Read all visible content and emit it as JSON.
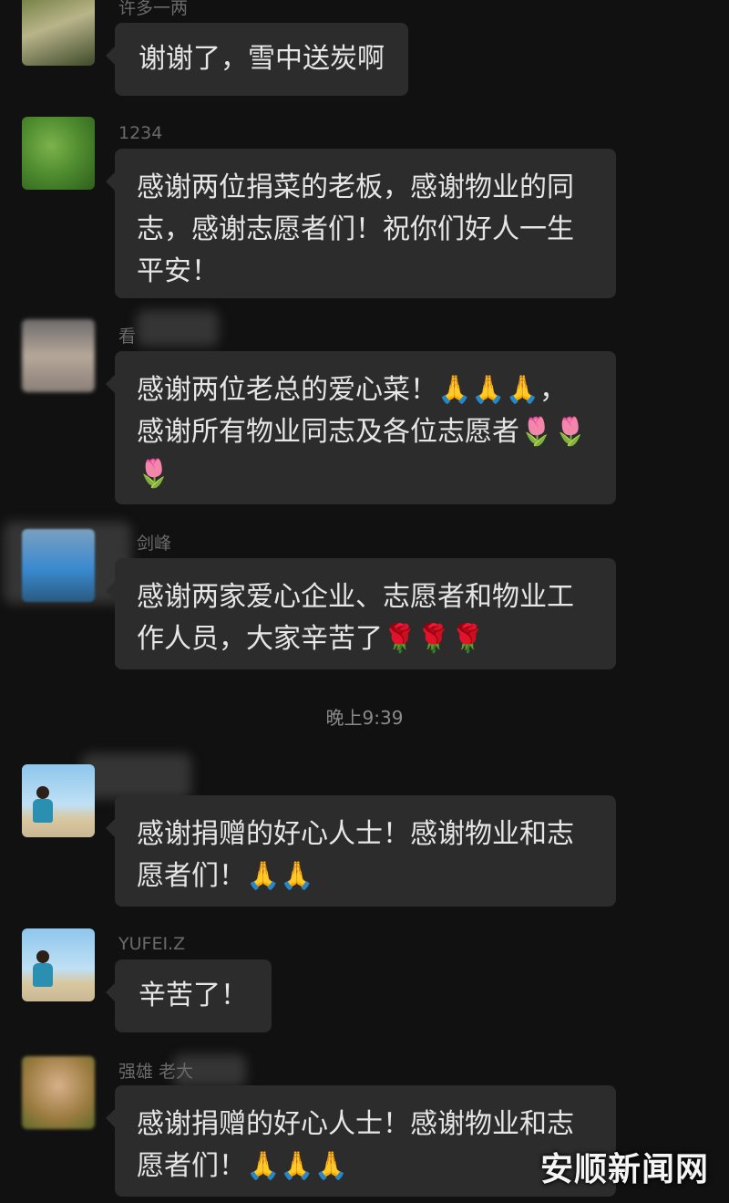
{
  "chat": {
    "messages": [
      {
        "sender": "许多一两",
        "text": "谢谢了，雪中送炭啊"
      },
      {
        "sender": "1234",
        "text": "感谢两位捐菜的老板，感谢物业的同志，感谢志愿者们！祝你们好人一生平安！"
      },
      {
        "sender": "看",
        "text": "感谢两位老总的爱心菜！🙏🙏🙏，感谢所有物业同志及各位志愿者🌷🌷🌷"
      },
      {
        "sender": "剑峰",
        "text": "感谢两家爱心企业、志愿者和物业工作人员，大家辛苦了🌹🌹🌹"
      },
      {
        "sender": "",
        "text": "感谢捐赠的好心人士！感谢物业和志愿者们！🙏🙏"
      },
      {
        "sender": "YUFEI.Z",
        "text": "辛苦了！"
      },
      {
        "sender": "强雄 老大",
        "text": "感谢捐赠的好心人士！感谢物业和志愿者们！🙏🙏🙏"
      }
    ],
    "timestamp": "晚上9:39"
  },
  "watermark": "安顺新闻网"
}
